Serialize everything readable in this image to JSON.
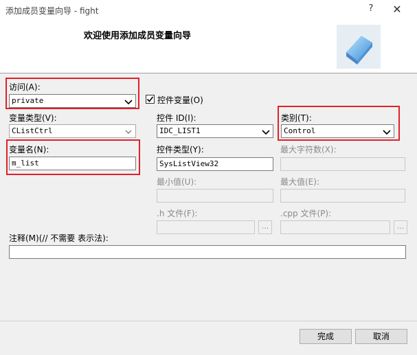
{
  "window": {
    "title": "添加成员变量向导 - fight",
    "help_glyph": "?",
    "close_glyph": "✕"
  },
  "header": {
    "title": "欢迎使用添加成员变量向导",
    "logo_icon": "cube-icon"
  },
  "access": {
    "label": "访问(A):",
    "value": "private"
  },
  "control_variable": {
    "label": "控件变量(O)",
    "checked": true
  },
  "variable_type": {
    "label": "变量类型(V):",
    "value": "CListCtrl"
  },
  "control_id": {
    "label": "控件 ID(I):",
    "value": "IDC_LIST1"
  },
  "category": {
    "label": "类别(T):",
    "value": "Control"
  },
  "variable_name": {
    "label": "变量名(N):",
    "value": "m_list"
  },
  "control_type": {
    "label": "控件类型(Y):",
    "value": "SysListView32"
  },
  "max_chars": {
    "label": "最大字符数(X):",
    "value": ""
  },
  "min_value": {
    "label": "最小值(U):",
    "value": ""
  },
  "max_value": {
    "label": "最大值(E):",
    "value": ""
  },
  "h_file": {
    "label": ".h 文件(F):",
    "value": "",
    "browse": "..."
  },
  "cpp_file": {
    "label": ".cpp 文件(P):",
    "value": "",
    "browse": "..."
  },
  "comment": {
    "label": "注释(M)(// 不需要 表示法):",
    "value": ""
  },
  "buttons": {
    "finish": "完成",
    "cancel": "取消"
  },
  "colors": {
    "highlight": "#e0202a",
    "background": "#f0f0f0"
  }
}
